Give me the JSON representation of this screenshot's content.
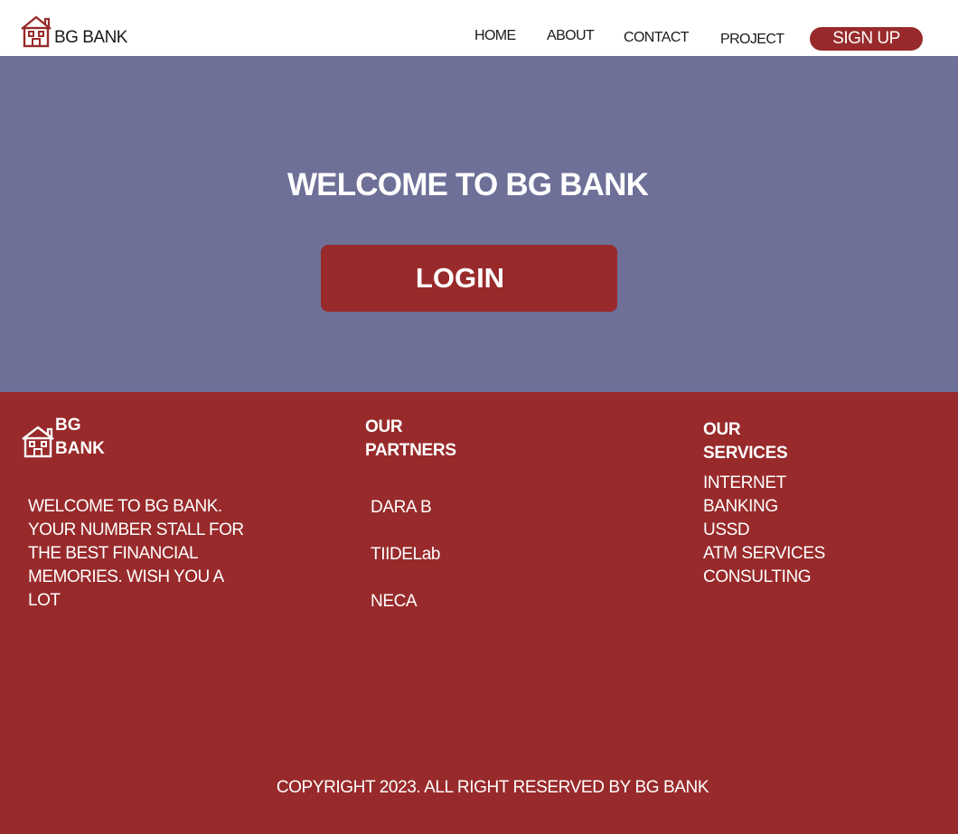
{
  "brand": {
    "name": "BG BANK"
  },
  "nav": {
    "items": [
      "HOME",
      "ABOUT",
      "CONTACT",
      "PROJECT"
    ],
    "signup_label": "SIGN UP"
  },
  "hero": {
    "title": "WELCOME TO BG BANK",
    "login_label": "LOGIN"
  },
  "footer": {
    "brand_line1": "BG",
    "brand_line2": "BANK",
    "about_text": "WELCOME TO BG BANK. YOUR NUMBER STALL FOR THE BEST FINANCIAL MEMORIES. WISH YOU A LOT",
    "partners_heading_line1": "OUR",
    "partners_heading_line2": "PARTNERS",
    "partners": [
      "DARA B",
      "TIIDELab",
      "NECA"
    ],
    "services_heading_line1": "OUR",
    "services_heading_line2": "SERVICES",
    "services": [
      "INTERNET BANKING",
      "USSD",
      "ATM SERVICES",
      "CONSULTING"
    ],
    "copyright": "COPYRIGHT 2023. ALL RIGHT RESERVED BY BG BANK"
  },
  "colors": {
    "primary": "#982a2b",
    "hero_bg": "#6e7098",
    "nav_bg": "#ffffff"
  },
  "icons": {
    "logo": "house-icon"
  }
}
